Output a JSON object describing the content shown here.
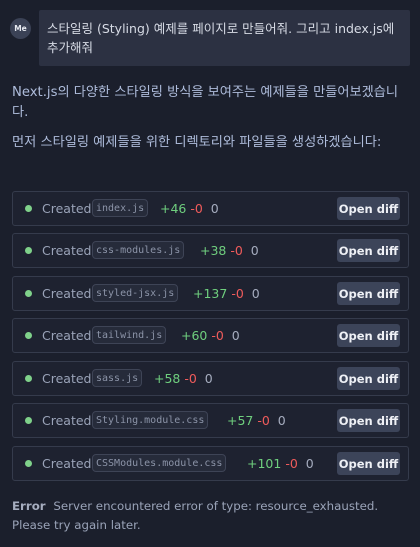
{
  "user_message": {
    "avatar": "Me",
    "text": "스타일링 (Styling) 예제를 페이지로 만들어줘. 그리고  index.js에 추가해줘"
  },
  "assistant": {
    "intro": "Next.js의 다양한 스타일링 방식을 보여주는 예제들을 만들어보겠습니다.",
    "intro2": "먼저 스타일링 예제들을 위한 디렉토리와 파일들을 생성하겠습니다:"
  },
  "files": [
    {
      "action": "Created",
      "name": "index.js",
      "added": "+46",
      "removed": "-0",
      "other": "0",
      "button": "Open diff"
    },
    {
      "action": "Created",
      "name": "css-modules.js",
      "added": "+38",
      "removed": "-0",
      "other": "0",
      "button": "Open diff"
    },
    {
      "action": "Created",
      "name": "styled-jsx.js",
      "added": "+137",
      "removed": "-0",
      "other": "0",
      "button": "Open diff"
    },
    {
      "action": "Created",
      "name": "tailwind.js",
      "added": "+60",
      "removed": "-0",
      "other": "0",
      "button": "Open diff"
    },
    {
      "action": "Created",
      "name": "sass.js",
      "added": "+58",
      "removed": "-0",
      "other": "0",
      "button": "Open diff"
    },
    {
      "action": "Created",
      "name": "Styling.module.css",
      "added": "+57",
      "removed": "-0",
      "other": "0",
      "button": "Open diff"
    },
    {
      "action": "Created",
      "name": "CSSModules.module.css",
      "added": "+101",
      "removed": "-0",
      "other": "0",
      "button": "Open diff"
    }
  ],
  "error": {
    "label": "Error",
    "message": "Server encountered error of type: resource_exhausted. Please try again later."
  },
  "colors": {
    "background": "#1b1f2c",
    "added": "#6fcf7e",
    "removed": "#ef5b5b",
    "status_dot": "#7fd18a",
    "button": "#3c4459"
  },
  "icons": {
    "status": "status-dot-icon"
  }
}
